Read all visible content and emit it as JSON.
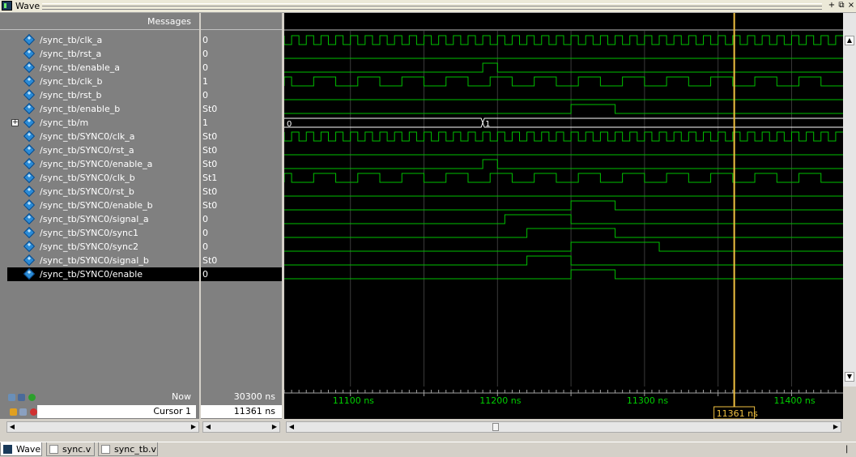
{
  "window": {
    "title": "Wave"
  },
  "columns": {
    "messages_header": "Messages"
  },
  "signals": [
    {
      "name": "/sync_tb/clk_a",
      "value": "0"
    },
    {
      "name": "/sync_tb/rst_a",
      "value": "0"
    },
    {
      "name": "/sync_tb/enable_a",
      "value": "0"
    },
    {
      "name": "/sync_tb/clk_b",
      "value": "1"
    },
    {
      "name": "/sync_tb/rst_b",
      "value": "0"
    },
    {
      "name": "/sync_tb/enable_b",
      "value": "St0"
    },
    {
      "name": "/sync_tb/m",
      "value": "1"
    },
    {
      "name": "/sync_tb/SYNC0/clk_a",
      "value": "St0"
    },
    {
      "name": "/sync_tb/SYNC0/rst_a",
      "value": "St0"
    },
    {
      "name": "/sync_tb/SYNC0/enable_a",
      "value": "St0"
    },
    {
      "name": "/sync_tb/SYNC0/clk_b",
      "value": "St1"
    },
    {
      "name": "/sync_tb/SYNC0/rst_b",
      "value": "St0"
    },
    {
      "name": "/sync_tb/SYNC0/enable_b",
      "value": "St0"
    },
    {
      "name": "/sync_tb/SYNC0/signal_a",
      "value": "0"
    },
    {
      "name": "/sync_tb/SYNC0/sync1",
      "value": "0"
    },
    {
      "name": "/sync_tb/SYNC0/sync2",
      "value": "0"
    },
    {
      "name": "/sync_tb/SYNC0/signal_b",
      "value": "St0"
    },
    {
      "name": "/sync_tb/SYNC0/enable",
      "value": "0"
    }
  ],
  "bus_m": {
    "before": "0",
    "after": "1"
  },
  "footer": {
    "now_label": "Now",
    "now_value": "30300 ns",
    "cursor_label": "Cursor 1",
    "cursor_value": "11361 ns",
    "cursor_marker": "11361 ns"
  },
  "timeline": {
    "range_ns": [
      11055,
      11435
    ],
    "ticks": [
      {
        "t": 11100,
        "label": "11100 ns"
      },
      {
        "t": 11200,
        "label": "11200 ns"
      },
      {
        "t": 11300,
        "label": "11300 ns"
      },
      {
        "t": 11400,
        "label": "11400 ns"
      }
    ],
    "cursor_ns": 11361
  },
  "waves": {
    "clk_a_period_ns": 10,
    "clk_b_period_ns": 30,
    "enable_a_pulse_ns": [
      11190,
      11200
    ],
    "enable_b_pulse_ns": [
      11250,
      11280
    ],
    "signal_a_pulse_ns": [
      11205,
      11250
    ],
    "sync1_pulse_ns": [
      11220,
      11280
    ],
    "sync2_pulse_ns": [
      11250,
      11310
    ],
    "signal_b_pulse_ns": [
      11220,
      11250
    ],
    "enable_pulse_ns": [
      11250,
      11280
    ],
    "m_change_ns": 11190
  },
  "tabs": [
    {
      "label": "Wave"
    },
    {
      "label": "sync.v"
    },
    {
      "label": "sync_tb.v"
    }
  ],
  "colors": {
    "wave": "#00c000",
    "cursor": "#f0c040",
    "grid": "#3a3a3a"
  }
}
